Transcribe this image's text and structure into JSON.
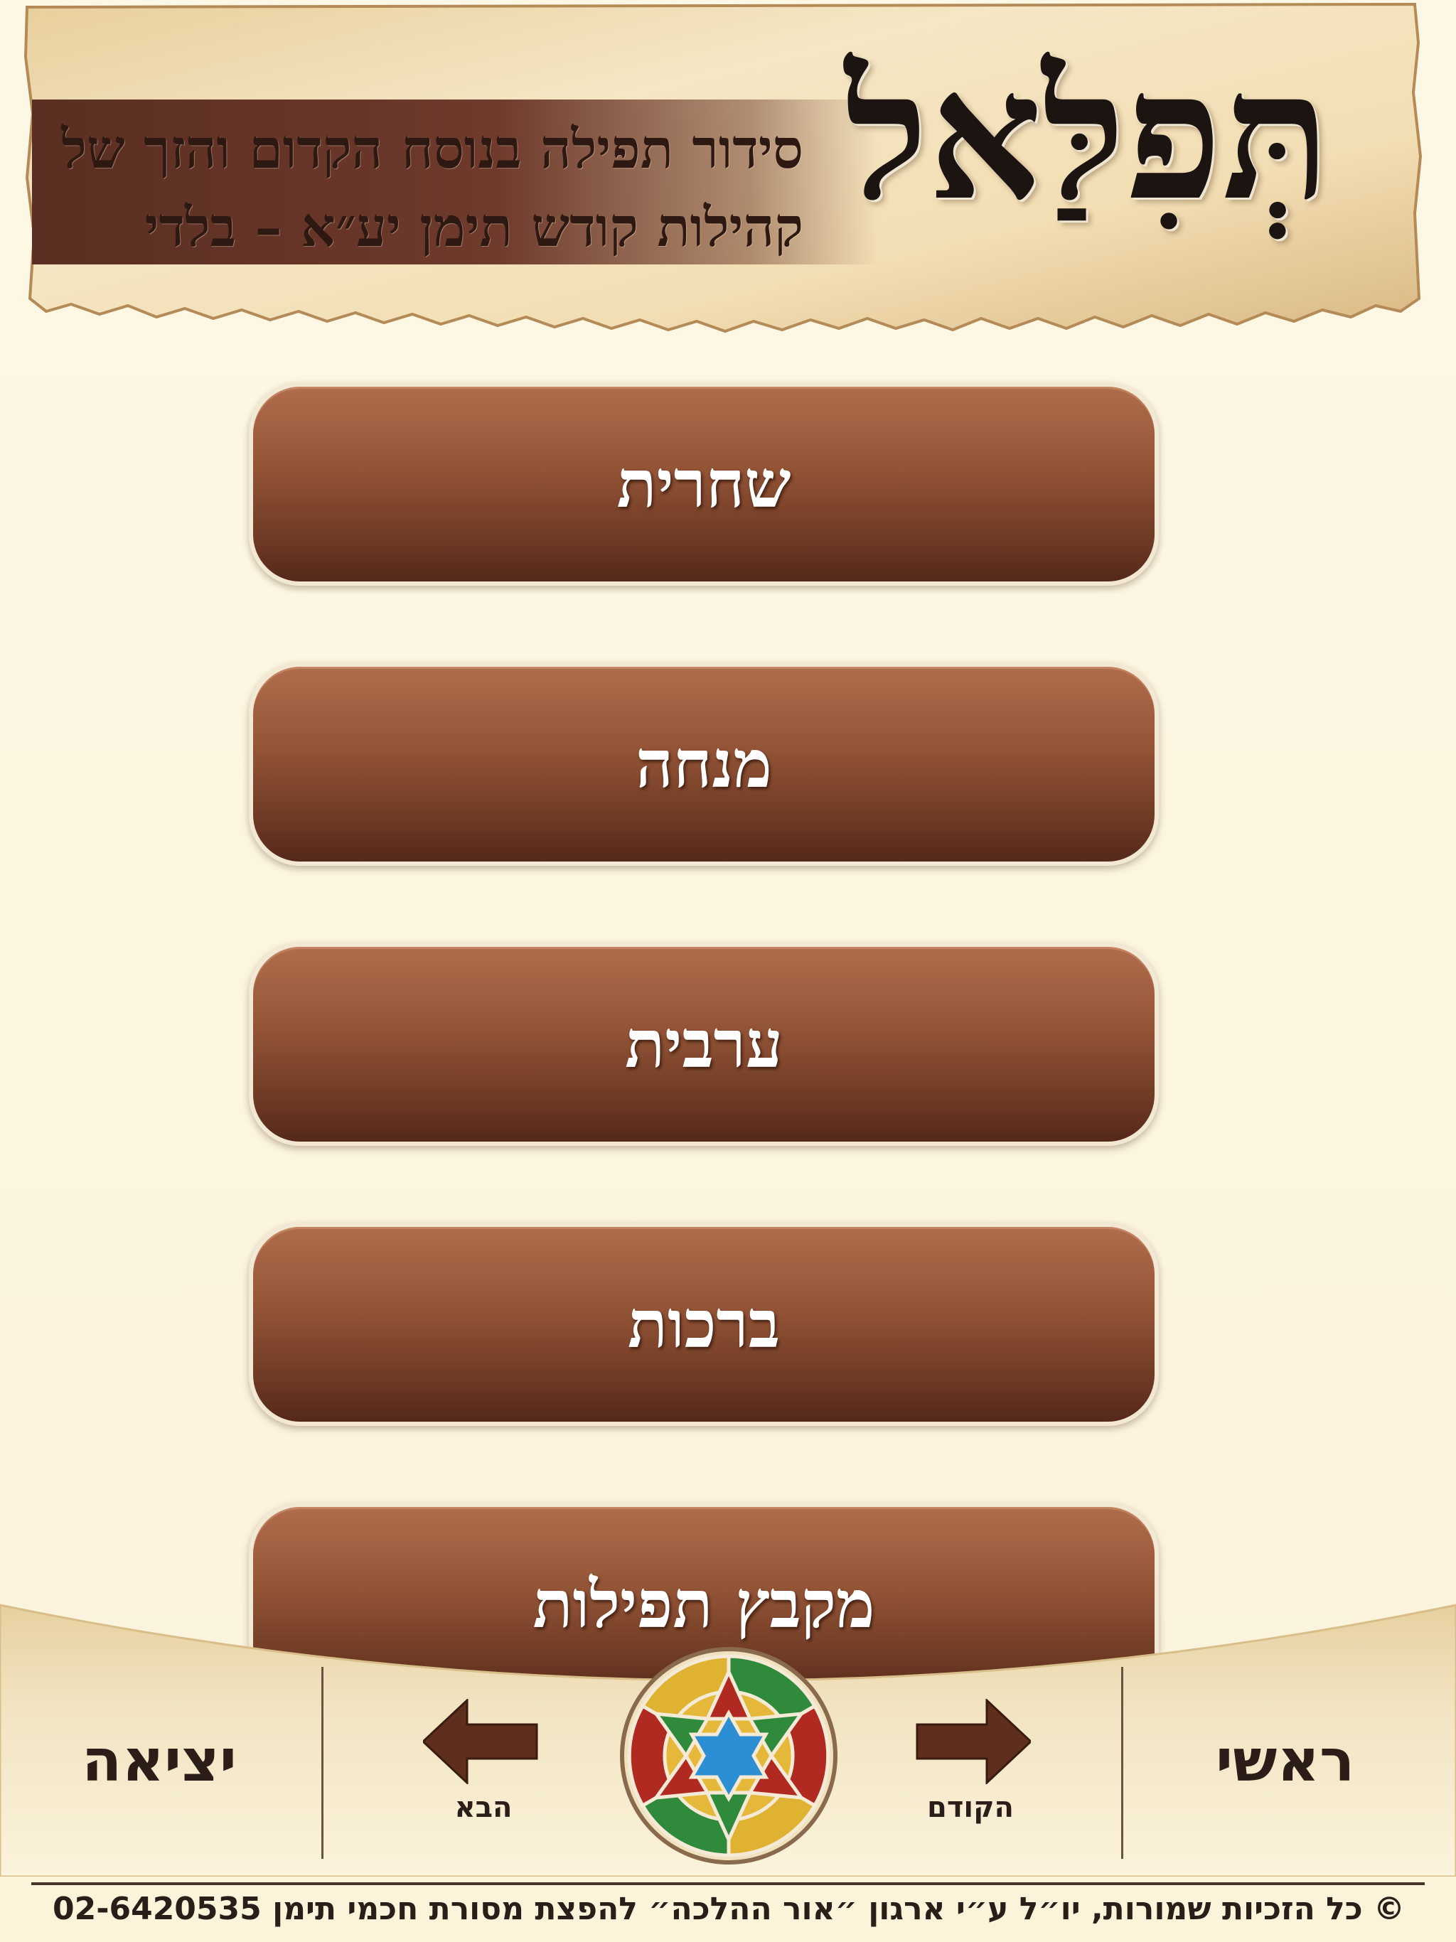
{
  "header": {
    "title": "תְּפִלַּאל",
    "subtitle_line1": "סידור תפילה בנוסח הקדום והזך של",
    "subtitle_line2": "קהילות קודש תימן יע״א – בלדי"
  },
  "menu": {
    "items": [
      {
        "label": "שחרית"
      },
      {
        "label": "מנחה"
      },
      {
        "label": "ערבית"
      },
      {
        "label": "ברכות"
      },
      {
        "label": "מקבץ תפילות"
      }
    ]
  },
  "nav": {
    "exit_label": "יציאה",
    "next_label": "הבא",
    "previous_label": "הקודם",
    "home_label": "ראשי",
    "next_icon": "arrow-left-icon",
    "previous_icon": "arrow-right-icon",
    "center_icon": "star-mosaic-icon"
  },
  "footer": {
    "copyright": "© כל הזכיות שמורות, יו״ל ע״י ארגון ״אור ההלכה״ להפצת מסורת חכמי תימן 02-6420535"
  },
  "colors": {
    "background": "#fcf6e2",
    "button_top": "#b06d4d",
    "button_bottom": "#55281a",
    "text_dark": "#2b1d18",
    "parchment": "#f0dcae"
  }
}
